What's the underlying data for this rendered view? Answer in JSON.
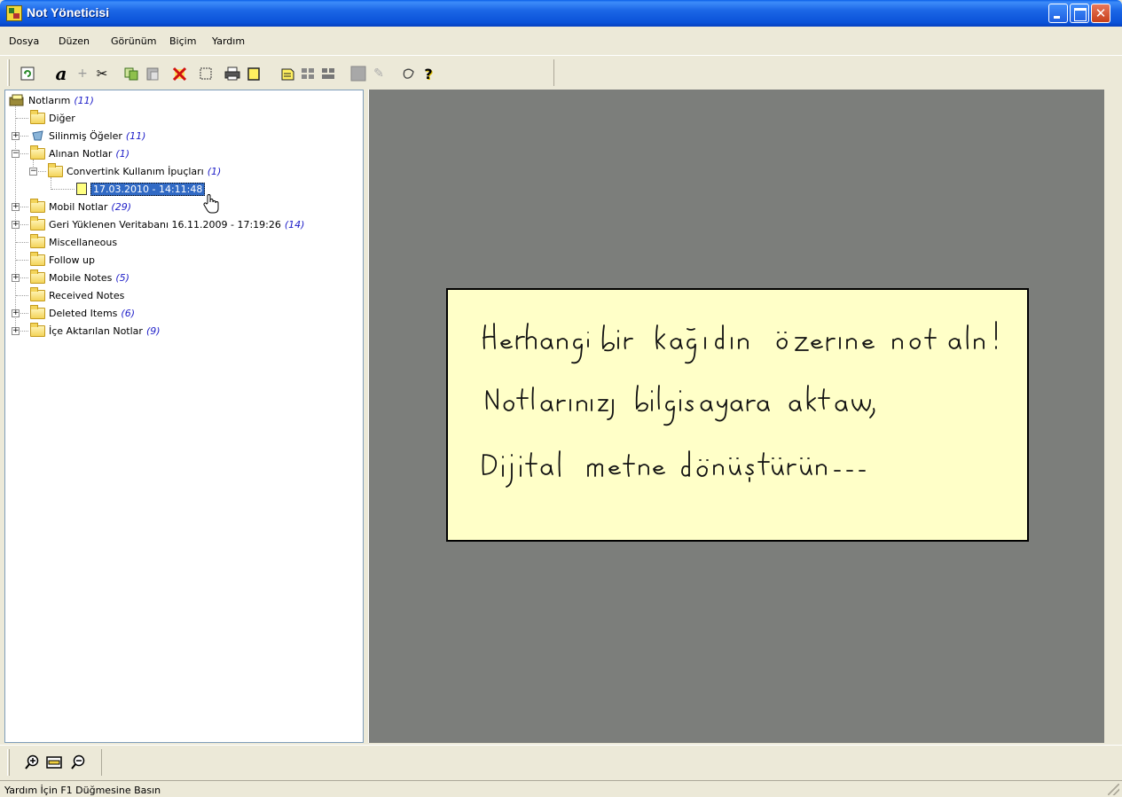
{
  "window": {
    "title": "Not Yöneticisi"
  },
  "menu": [
    "Dosya",
    "Düzen",
    "Görünüm",
    "Biçim",
    "Yardım"
  ],
  "toolbar_icons": [
    "refresh-icon",
    "font-icon",
    "add-icon",
    "cut-icon",
    "copy-icon",
    "paste-icon",
    "delete-icon",
    "select-icon",
    "print-icon",
    "new-note-icon",
    "note-view-icon",
    "grid-view-icon",
    "tile-view-icon",
    "color-icon",
    "pen-icon",
    "recognize-icon",
    "help-icon"
  ],
  "tree": {
    "root": {
      "label": "Notlarım",
      "count": "(11)"
    },
    "items": [
      {
        "label": "Diğer",
        "count": ""
      },
      {
        "label": "Silinmiş Öğeler",
        "count": "(11)"
      },
      {
        "label": "Alınan Notlar",
        "count": "(1)"
      },
      {
        "label": "Convertink Kullanım İpuçları",
        "count": "(1)"
      },
      {
        "label": "17.03.2010 - 14:11:48",
        "count": ""
      },
      {
        "label": "Mobil Notlar",
        "count": "(29)"
      },
      {
        "label": "Geri Yüklenen Veritabanı 16.11.2009 - 17:19:26",
        "count": "(14)"
      },
      {
        "label": "Miscellaneous",
        "count": ""
      },
      {
        "label": "Follow up",
        "count": ""
      },
      {
        "label": "Mobile Notes",
        "count": "(5)"
      },
      {
        "label": "Received Notes",
        "count": ""
      },
      {
        "label": "Deleted Items",
        "count": "(6)"
      },
      {
        "label": "İçe Aktarılan Notlar",
        "count": "(9)"
      }
    ]
  },
  "note": {
    "lines": [
      "Herhangi bir kağıdın üzerine not alın!",
      "Notlarınızı bilgisayara aktarın,",
      "Dijital metne dönüştürün..."
    ]
  },
  "zoom_icons": [
    "zoom-in-icon",
    "fit-page-icon",
    "zoom-out-icon"
  ],
  "status": {
    "text": "Yardım İçin F1 Düğmesine Basın"
  },
  "colors": {
    "titlebar": "#0a52d8",
    "preview_bg": "#7c7e7b",
    "note_bg": "#ffffc8",
    "selection": "#316ac5",
    "count_text": "#1e1ec8"
  }
}
